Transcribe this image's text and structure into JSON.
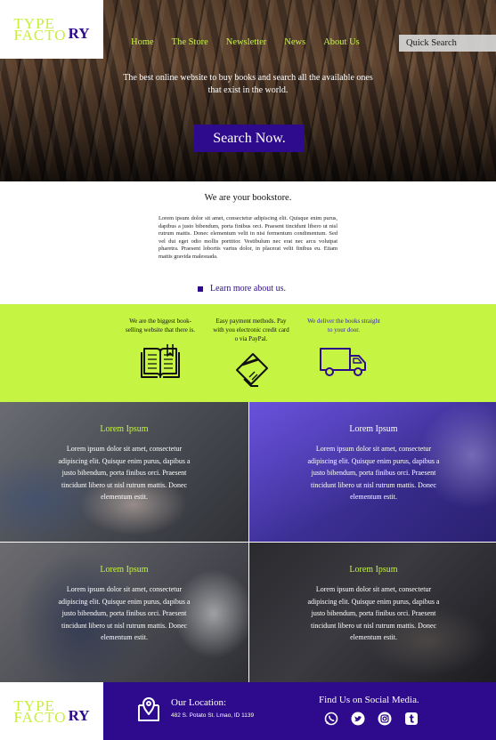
{
  "brand": {
    "logo_line1": "TYPE",
    "logo_line2": "FACTO",
    "logo_tail": "RY"
  },
  "nav": {
    "items": [
      "Home",
      "The Store",
      "Newsletter",
      "News",
      "About Us"
    ]
  },
  "search": {
    "placeholder": "Quick Search"
  },
  "hero": {
    "tagline": "The best online website to buy books and search all the available ones that exist in the world.",
    "cta_label": "Search Now."
  },
  "about": {
    "heading": "We are your bookstore.",
    "body": "Lorem ipsum dolor sit amet, consectetur adipiscing elit. Quisque enim purus, dapibus a justo bibendum, porta finibus orci. Praesent tincidunt libero ut nisl rutrum mattis. Donec elementum velit in nisi fermentum condimentum. Sed vel dui eget odio mollis porttitor. Vestibulum nec erat nec arcu volutpat pharetra. Praesent lobortis varius dolor, in placerat velit finibus eu. Etiam mattis gravida malesuada.",
    "link_label": "Learn more about us."
  },
  "features": [
    {
      "text": "We are the biggest book-selling website that there is.",
      "icon": "book-icon"
    },
    {
      "text": "Easy payment methods. Pay with you electronic credit card o via PayPal.",
      "icon": "credit-card-icon"
    },
    {
      "text": "We deliver the books straight to your door.",
      "icon": "delivery-truck-icon"
    }
  ],
  "tiles": [
    {
      "title": "Lorem Ipsum",
      "body": "Lorem ipsum dolor sit amet, consectetur adipiscing elit. Quisque enim purus, dapibus a justo bibendum, porta finibus orci. Praesent tincidunt libero ut nisl rutrum mattis. Donec elementum estit."
    },
    {
      "title": "Lorem Ipsum",
      "body": "Lorem ipsum dolor sit amet, consectetur adipiscing elit. Quisque enim purus, dapibus a justo bibendum, porta finibus orci. Praesent tincidunt libero ut nisl rutrum mattis. Donec elementum estit."
    },
    {
      "title": "Lorem Ipsum",
      "body": "Lorem ipsum dolor sit amet, consectetur adipiscing elit. Quisque enim purus, dapibus a justo bibendum, porta finibus orci. Praesent tincidunt libero ut nisl rutrum mattis. Donec elementum estit."
    },
    {
      "title": "Lorem Ipsum",
      "body": "Lorem ipsum dolor sit amet, consectetur adipiscing elit. Quisque enim purus, dapibus a justo bibendum, porta finibus orci. Praesent tincidunt libero ut nisl rutrum mattis. Donec elementum estit."
    }
  ],
  "footer": {
    "location_title": "Our Location:",
    "address": "482 S. Potato St.  Lmao, ID 1139",
    "social_title": "Find Us on Social Media.",
    "social_icons": [
      "whatsapp-icon",
      "twitter-icon",
      "instagram-icon",
      "tumblr-icon"
    ]
  },
  "colors": {
    "brand_purple": "#2e0a8c",
    "lime": "#c5f542",
    "nav_text": "#c6f24a",
    "tile_title_lime": "#c6f24a",
    "tile_title_white": "#ffffff"
  }
}
